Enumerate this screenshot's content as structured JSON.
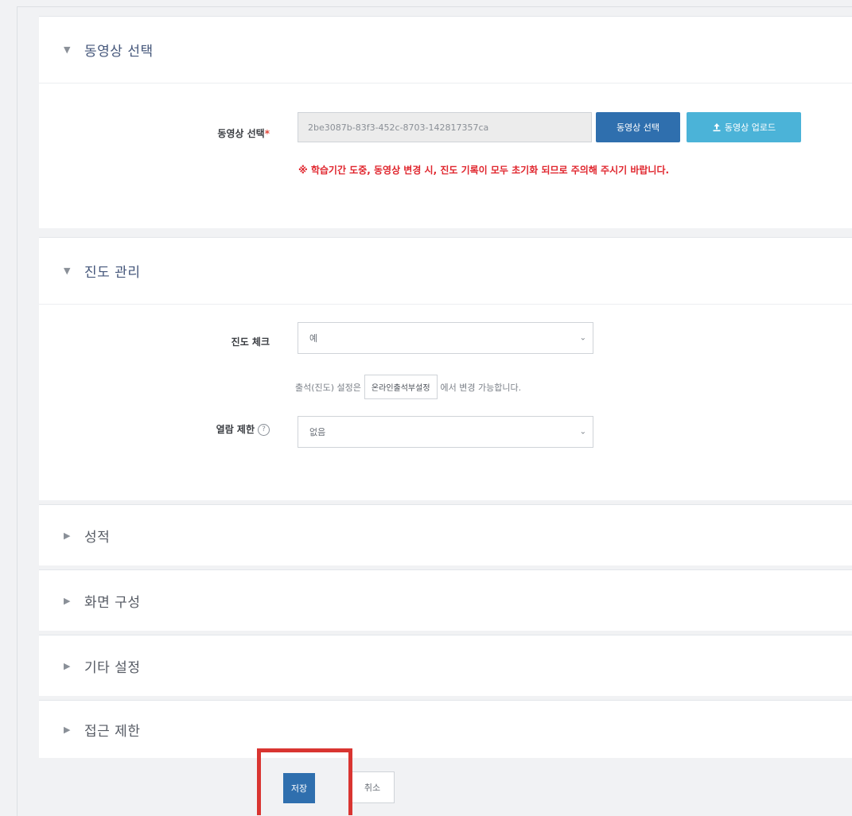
{
  "sections": {
    "video": {
      "title": "동영상 선택",
      "label": "동영상 선택",
      "required_mark": "*",
      "video_id": "2be3087b-83f3-452c-8703-142817357ca",
      "select_button": "동영상 선택",
      "upload_icon": "upload-icon",
      "upload_button": "동영상 업로드",
      "warning": "※ 학습기간 도중, 동영상 변경 시, 진도 기록이 모두 초기화 되므로 주의해 주시기 바랍니다."
    },
    "progress": {
      "title": "진도 관리",
      "check_label": "진도 체크",
      "check_value": "예",
      "hint_prefix": "출석(진도) 설정은",
      "hint_link": "온라인출석부설정",
      "hint_suffix": "에서 변경 가능합니다.",
      "limit_label": "열람 제한",
      "limit_value": "없음"
    },
    "grade": {
      "title": "성적"
    },
    "layout": {
      "title": "화면 구성"
    },
    "other": {
      "title": "기타 설정"
    },
    "access": {
      "title": "접근 제한"
    }
  },
  "footer": {
    "save": "저장",
    "cancel": "취소"
  },
  "colors": {
    "primary": "#2f6fae",
    "upload": "#4bb3d8",
    "warning": "#e0262e",
    "highlight": "#d93531"
  }
}
